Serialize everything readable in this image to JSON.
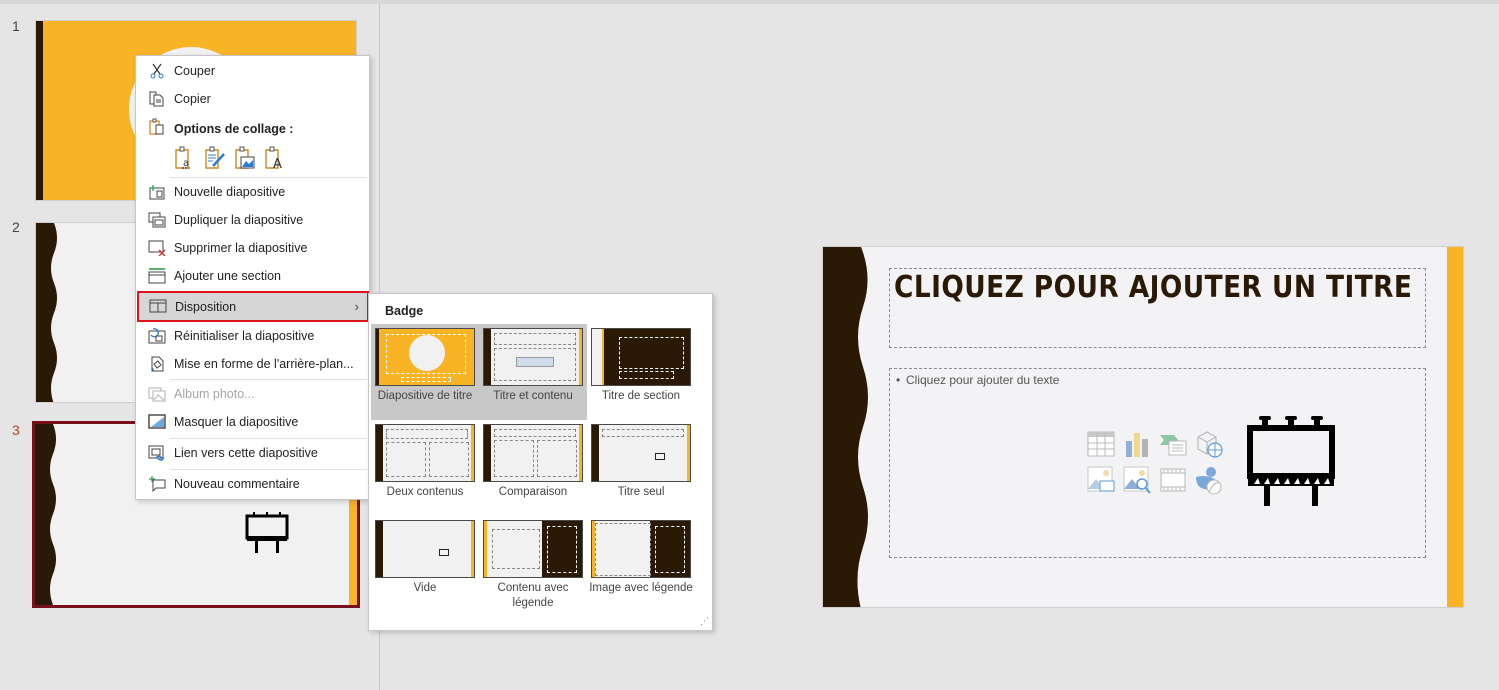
{
  "thumbnails": [
    {
      "number": "1",
      "layout": "title-slide",
      "selected": false
    },
    {
      "number": "2",
      "layout": "title-and-content",
      "selected": false
    },
    {
      "number": "3",
      "layout": "title-only-with-billboard",
      "selected": true
    }
  ],
  "context_menu": {
    "items": [
      {
        "label": "Couper",
        "icon": "scissors-icon",
        "enabled": true
      },
      {
        "label": "Copier",
        "icon": "copy-icon",
        "enabled": true
      }
    ],
    "paste_heading": "Options de collage :",
    "paste_options": [
      {
        "name": "paste-use-destination-theme-icon"
      },
      {
        "name": "paste-keep-source-formatting-icon"
      },
      {
        "name": "paste-picture-icon"
      },
      {
        "name": "paste-keep-text-only-icon"
      }
    ],
    "slide_items": [
      {
        "label": "Nouvelle diapositive",
        "icon": "new-slide-icon",
        "enabled": true
      },
      {
        "label": "Dupliquer la diapositive",
        "icon": "duplicate-slide-icon",
        "enabled": true
      },
      {
        "label": "Supprimer la diapositive",
        "icon": "delete-slide-icon",
        "enabled": true
      },
      {
        "label": "Ajouter une section",
        "icon": "add-section-icon",
        "enabled": true
      },
      {
        "label": "Disposition",
        "icon": "layout-icon",
        "enabled": true,
        "has_submenu": true,
        "highlighted": true
      },
      {
        "label": "Réinitialiser la diapositive",
        "icon": "reset-slide-icon",
        "enabled": true
      },
      {
        "label": "Mise en forme de l'arrière-plan...",
        "icon": "format-background-icon",
        "enabled": true
      },
      {
        "label": "Album photo...",
        "icon": "photo-album-icon",
        "enabled": false
      },
      {
        "label": "Masquer la diapositive",
        "icon": "hide-slide-icon",
        "enabled": true
      },
      {
        "label": "Lien vers cette diapositive",
        "icon": "link-slide-icon",
        "enabled": true
      },
      {
        "label": "Nouveau commentaire",
        "icon": "new-comment-icon",
        "enabled": true
      }
    ],
    "submenu_chevron": "›"
  },
  "layout_submenu": {
    "title": "Badge",
    "layouts": [
      {
        "label": "Diapositive de titre",
        "hovered": true
      },
      {
        "label": "Titre et contenu",
        "hovered": true
      },
      {
        "label": "Titre de section"
      },
      {
        "label": "Deux contenus"
      },
      {
        "label": "Comparaison"
      },
      {
        "label": "Titre seul"
      },
      {
        "label": "Vide"
      },
      {
        "label": "Contenu avec légende"
      },
      {
        "label": "Image avec légende"
      }
    ],
    "resize_grip": "⋰"
  },
  "main_slide": {
    "title_placeholder": "CLIQUEZ POUR AJOUTER UN TITRE",
    "body_placeholder": "Cliquez pour ajouter du texte",
    "bullet": "•",
    "insert_icons": [
      "insert-table-icon",
      "insert-chart-icon",
      "insert-smartart-icon",
      "insert-3d-model-icon",
      "insert-picture-icon",
      "insert-stock-images-icon",
      "insert-video-icon",
      "insert-icons-icon"
    ]
  },
  "colors": {
    "theme_gold": "#f8b425",
    "theme_dark_brown": "#2a1a05",
    "selection_border": "#7a0f1c",
    "highlight_outline": "#e0121c"
  }
}
